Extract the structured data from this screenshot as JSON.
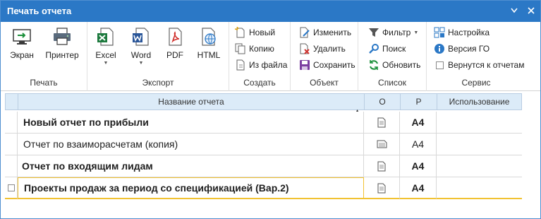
{
  "window": {
    "title": "Печать отчета"
  },
  "ribbon": {
    "print_group": {
      "label": "Печать",
      "buttons": [
        {
          "label": "Экран"
        },
        {
          "label": "Принтер"
        }
      ]
    },
    "export_group": {
      "label": "Экспорт",
      "buttons": [
        {
          "label": "Excel"
        },
        {
          "label": "Word"
        },
        {
          "label": "PDF"
        },
        {
          "label": "HTML"
        }
      ]
    },
    "create_group": {
      "label": "Создать",
      "buttons": [
        {
          "label": "Новый"
        },
        {
          "label": "Копию"
        },
        {
          "label": "Из файла"
        }
      ]
    },
    "object_group": {
      "label": "Объект",
      "buttons": [
        {
          "label": "Изменить"
        },
        {
          "label": "Удалить"
        },
        {
          "label": "Сохранить"
        }
      ]
    },
    "list_group": {
      "label": "Список",
      "buttons": [
        {
          "label": "Фильтр"
        },
        {
          "label": "Поиск"
        },
        {
          "label": "Обновить"
        }
      ]
    },
    "service_group": {
      "label": "Сервис",
      "buttons": [
        {
          "label": "Настройка"
        },
        {
          "label": "Версия ГО"
        },
        {
          "label": "Вернутся к отчетам"
        }
      ]
    }
  },
  "grid": {
    "columns": [
      "Название отчета",
      "О",
      "Р",
      "Использование"
    ],
    "rows": [
      {
        "name": "Новый отчет  по прибыли",
        "p": "A4",
        "bold": true
      },
      {
        "name": "Отчет по взаиморасчетам (копия)",
        "p": "A4",
        "bold": false
      },
      {
        "name": "Отчет по входящим лидам",
        "p": "A4",
        "bold": true
      },
      {
        "name": "Проекты продаж за период со спецификацией (Вар.2)",
        "p": "A4",
        "bold": true
      }
    ]
  },
  "colors": {
    "titlebar": "#2b78c6",
    "header": "#dcebf8",
    "selection_border": "#f1c232"
  }
}
